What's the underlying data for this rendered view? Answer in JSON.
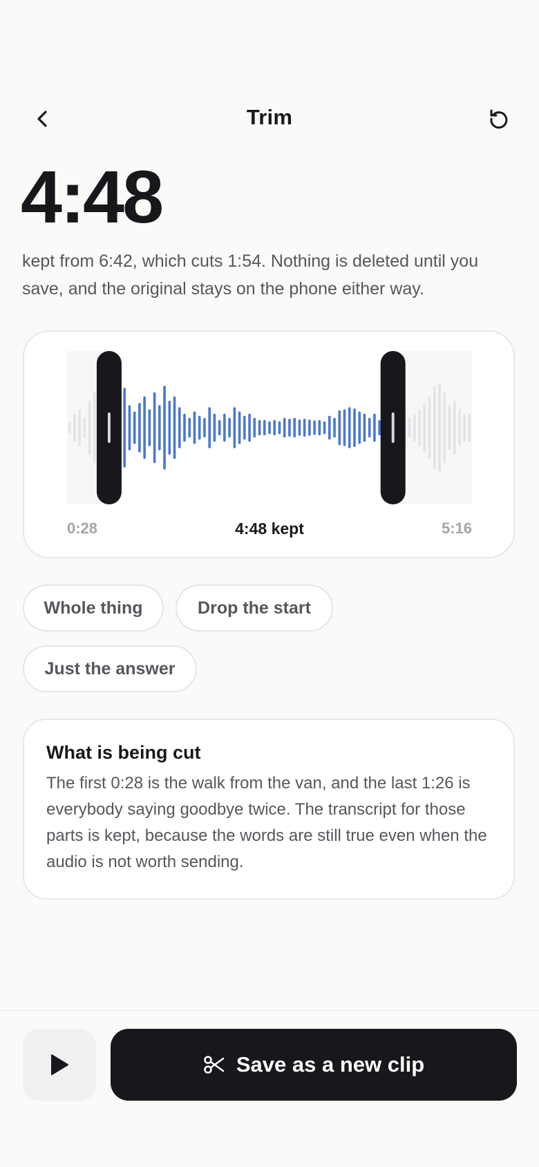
{
  "header": {
    "title": "Trim"
  },
  "clip": {
    "kept_duration": "4:48",
    "summary": "kept from 6:42, which cuts 1:54. Nothing is deleted until you save, and the original stays on the phone either way."
  },
  "waveform": {
    "start_label": "0:28",
    "kept_label": "4:48 kept",
    "end_label": "5:16",
    "colors": {
      "kept": "#4a78d2",
      "cut": "#e3e4e6",
      "handle": "#17181b"
    },
    "amplitudes": [
      0.1,
      0.3,
      0.4,
      0.2,
      0.6,
      0.8,
      0.5,
      1.0,
      0.7,
      0.85,
      0.6,
      0.9,
      0.5,
      0.35,
      0.55,
      0.7,
      0.4,
      0.8,
      0.5,
      0.95,
      0.6,
      0.7,
      0.45,
      0.3,
      0.2,
      0.35,
      0.25,
      0.2,
      0.45,
      0.3,
      0.15,
      0.3,
      0.2,
      0.45,
      0.35,
      0.25,
      0.3,
      0.2,
      0.15,
      0.15,
      0.12,
      0.15,
      0.12,
      0.2,
      0.18,
      0.2,
      0.16,
      0.18,
      0.16,
      0.14,
      0.15,
      0.12,
      0.25,
      0.2,
      0.38,
      0.4,
      0.45,
      0.42,
      0.35,
      0.3,
      0.2,
      0.3,
      0.15,
      0.25,
      0.4,
      0.6,
      0.7,
      0.5,
      0.2,
      0.3,
      0.4,
      0.55,
      0.7,
      0.95,
      1.0,
      0.8,
      0.5,
      0.6,
      0.4,
      0.3,
      0.3
    ],
    "trim_start_fraction": 0.104,
    "trim_end_fraction": 0.805
  },
  "presets": [
    {
      "label": "Whole thing"
    },
    {
      "label": "Drop the start"
    },
    {
      "label": "Just the answer"
    }
  ],
  "info": {
    "heading": "What is being cut",
    "body": "The first 0:28 is the walk from the van, and the last 1:26 is everybody saying goodbye twice. The transcript for those parts is kept, because the words are still true even when the audio is not worth sending."
  },
  "actions": {
    "save_label": "Save as a new clip"
  },
  "icons": {
    "back": "chevron-left-icon",
    "reset": "undo-icon",
    "play": "play-icon",
    "save": "scissors-icon"
  }
}
